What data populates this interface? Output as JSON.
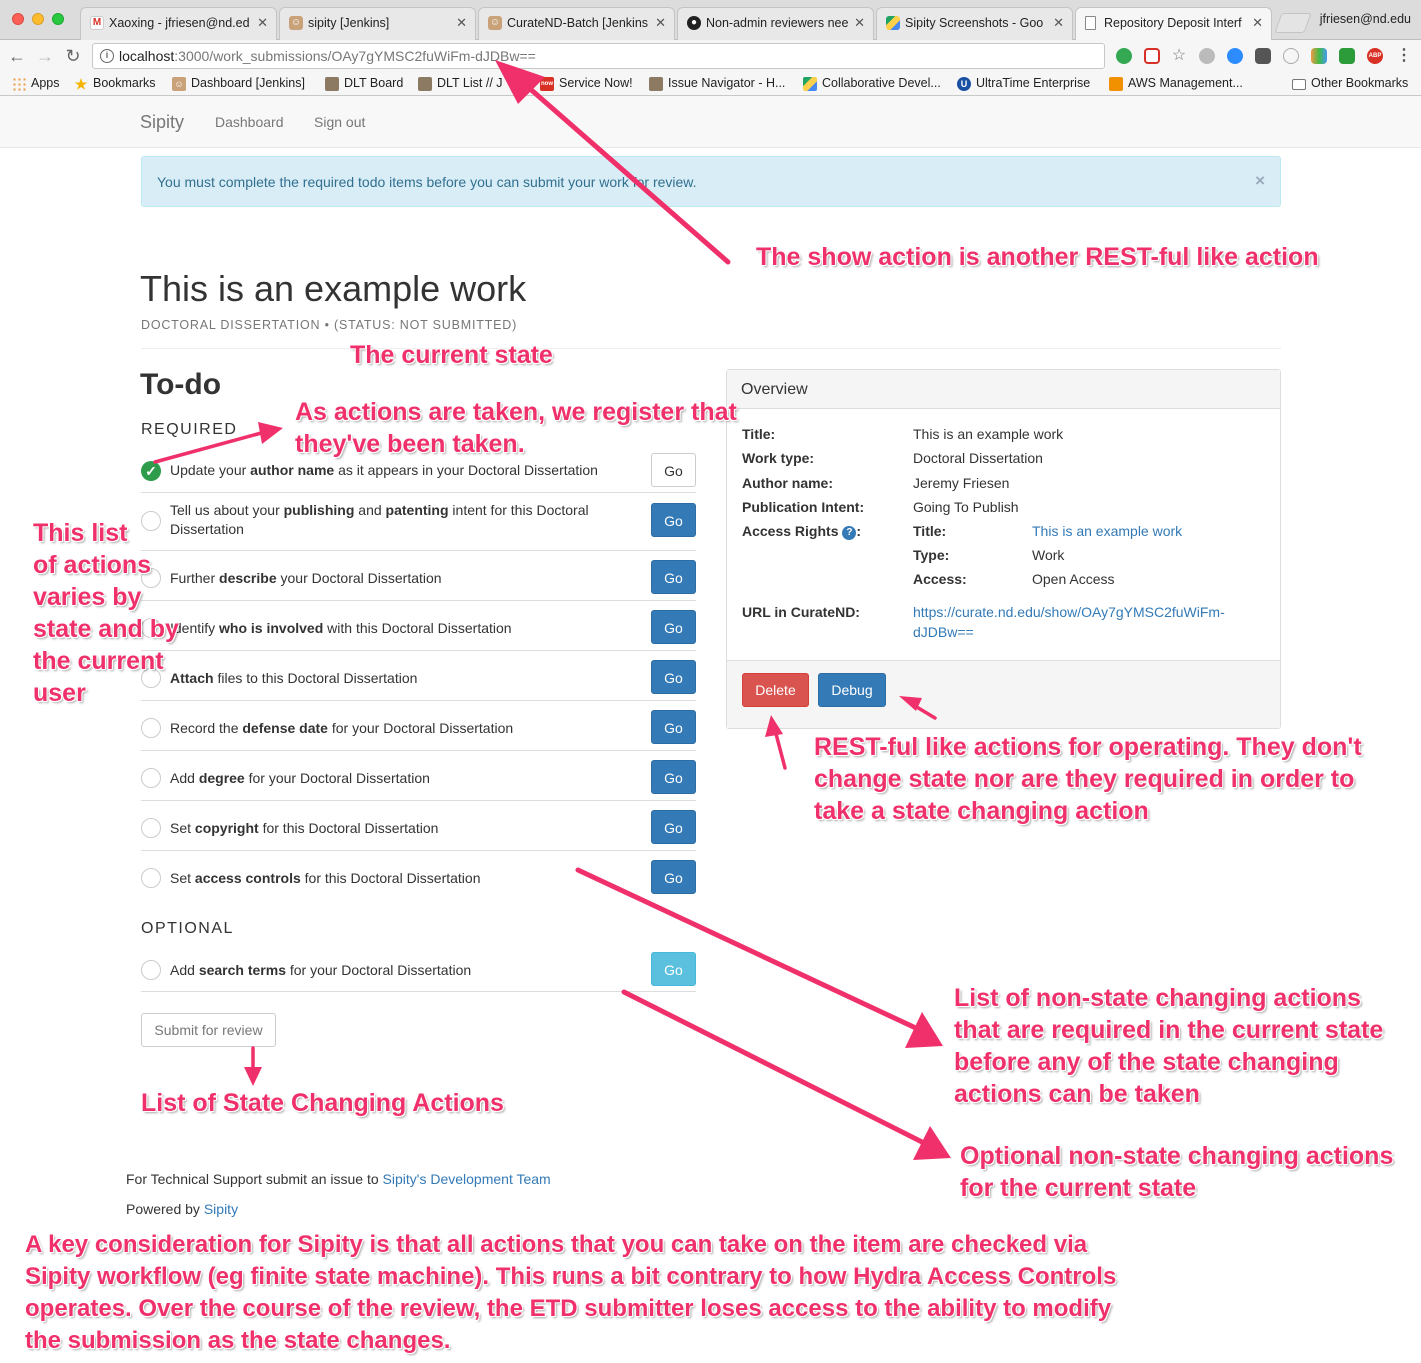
{
  "browser": {
    "tabs": [
      {
        "title": "Xaoxing - jfriesen@nd.ed",
        "icon": "gmail-icon",
        "color": "#d93025"
      },
      {
        "title": "sipity [Jenkins]",
        "icon": "jenkins-icon",
        "color": "#8a6d4b"
      },
      {
        "title": "CurateND-Batch [Jenkins",
        "icon": "jenkins-icon",
        "color": "#8a6d4b"
      },
      {
        "title": "Non-admin reviewers nee",
        "icon": "github-icon",
        "color": "#222222"
      },
      {
        "title": "Sipity Screenshots - Goo",
        "icon": "drive-icon",
        "color": "#1fa463"
      },
      {
        "title": "Repository Deposit Interf",
        "icon": "page-icon",
        "color": "#777777"
      }
    ],
    "profile": "jfriesen@nd.edu",
    "url_host": "localhost",
    "url_rest": ":3000/work_submissions/OAy7gYMSC2fuWiFm-dJDBw==",
    "bookmarks": [
      {
        "label": "Apps",
        "icon": "apps-icon"
      },
      {
        "label": "Bookmarks",
        "icon": "star-icon"
      },
      {
        "label": "Dashboard [Jenkins]",
        "icon": "jenkins-icon"
      },
      {
        "label": "DLT Board",
        "icon": "board-icon"
      },
      {
        "label": "DLT List // J",
        "icon": "board-icon"
      },
      {
        "label": "Service Now!",
        "icon": "servicenow-icon"
      },
      {
        "label": "Issue Navigator - H...",
        "icon": "board-icon"
      },
      {
        "label": "Collaborative Devel...",
        "icon": "drive-icon"
      },
      {
        "label": "UltraTime Enterprise",
        "icon": "ultratime-icon"
      },
      {
        "label": "AWS Management...",
        "icon": "aws-icon"
      },
      {
        "label": "Other Bookmarks",
        "icon": "folder-icon"
      }
    ]
  },
  "nav": {
    "brand": "Sipity",
    "links": [
      "Dashboard",
      "Sign out"
    ]
  },
  "alert": {
    "text": "You must complete the required todo items before you can submit your work for review.",
    "close": "×"
  },
  "work": {
    "title": "This is an example work",
    "subtitle": "DOCTORAL DISSERTATION • (STATUS: NOT SUBMITTED)"
  },
  "todo": {
    "heading": "To-do",
    "required_heading": "REQUIRED",
    "optional_heading": "OPTIONAL",
    "go_label": "Go",
    "required": [
      {
        "pre": "Update your ",
        "bold": "author name",
        "post": " as it appears in your Doctoral Dissertation",
        "done": true
      },
      {
        "pre": "Tell us about your ",
        "bold": "publishing",
        "mid": " and ",
        "bold2": "patenting",
        "post": " intent for this Doctoral Dissertation",
        "done": false
      },
      {
        "pre": "Further ",
        "bold": "describe",
        "post": " your Doctoral Dissertation",
        "done": false
      },
      {
        "pre": "Identify ",
        "bold": "who is involved",
        "post": " with this Doctoral Dissertation",
        "done": false
      },
      {
        "pre": "",
        "bold": "Attach",
        "post": " files to this Doctoral Dissertation",
        "done": false
      },
      {
        "pre": "Record the ",
        "bold": "defense date",
        "post": " for your Doctoral Dissertation",
        "done": false
      },
      {
        "pre": "Add ",
        "bold": "degree",
        "post": " for your Doctoral Dissertation",
        "done": false
      },
      {
        "pre": "Set ",
        "bold": "copyright",
        "post": " for this Doctoral Dissertation",
        "done": false
      },
      {
        "pre": "Set ",
        "bold": "access controls",
        "post": " for this Doctoral Dissertation",
        "done": false
      }
    ],
    "optional": [
      {
        "pre": "Add ",
        "bold": "search terms",
        "post": " for your Doctoral Dissertation",
        "done": false
      }
    ],
    "submit_label": "Submit for review"
  },
  "overview": {
    "heading": "Overview",
    "fields": [
      {
        "label": "Title:",
        "value": "This is an example work"
      },
      {
        "label": "Work type:",
        "value": "Doctoral Dissertation"
      },
      {
        "label": "Author name:",
        "value": "Jeremy Friesen"
      },
      {
        "label": "Publication Intent:",
        "value": "Going To Publish"
      }
    ],
    "access_rights_label": "Access Rights",
    "access": [
      {
        "label": "Title:",
        "value": "This is an example work"
      },
      {
        "label": "Type:",
        "value": "Work"
      },
      {
        "label": "Access:",
        "value": "Open Access"
      }
    ],
    "url_label": "URL in CurateND:",
    "url_line1": "https://curate.nd.edu/show/OAy7gYMSC2fuWiFm-",
    "url_line2": "dJDBw==",
    "delete_label": "Delete",
    "debug_label": "Debug"
  },
  "footer": {
    "support_text": "For Technical Support submit an issue to ",
    "support_link": "Sipity's Development Team",
    "powered_text": "Powered by ",
    "powered_link": "Sipity"
  },
  "annotations": {
    "show_action": "The show action is another REST-ful like action",
    "current_state": "The current state",
    "registered": [
      "As actions are taken, we register that",
      "they've been taken."
    ],
    "list_varies": [
      "This list",
      "of actions",
      "varies by",
      "state and by",
      "the current",
      "user"
    ],
    "restful": [
      "REST-ful like actions for operating. They don't",
      "change state nor are they required in order to",
      "take a state changing action"
    ],
    "non_state_required": [
      "List of non-state changing actions",
      "that are required in the current state",
      "before any of the state changing",
      "actions can be taken"
    ],
    "optional_actions": [
      "Optional non-state changing actions",
      "for the current state"
    ],
    "state_changing": "List of State Changing Actions",
    "key_consideration": [
      "A key consideration for Sipity is that all actions that you can take on the item are checked via",
      "Sipity workflow (eg finite state machine). This runs a bit contrary to how Hydra Access Controls",
      "operates. Over the course of the review, the ETD submitter loses access to the ability to modify",
      "the submission as the state changes."
    ]
  },
  "colors": {
    "annotation": "#f0306a",
    "primary": "#337ab7",
    "danger": "#d9534f",
    "info": "#5bc0de",
    "success": "#2e9c4a"
  }
}
